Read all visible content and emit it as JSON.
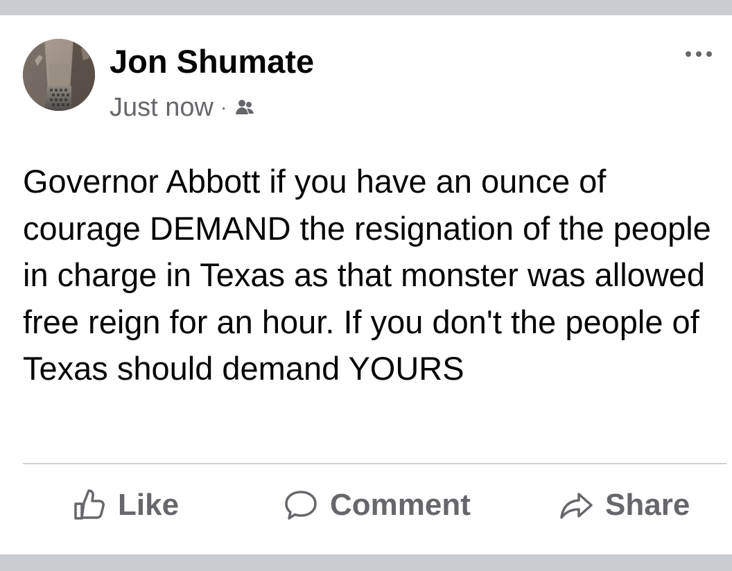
{
  "post": {
    "author": "Jon Shumate",
    "timestamp": "Just now",
    "separator": "·",
    "audience_icon": "friends-icon",
    "more_icon": "more-options-icon",
    "body": "Governor Abbott if you have an ounce of courage DEMAND the resignation of the people in charge in Texas as that monster was allowed free reign for an hour. If you don't the people of Texas should demand YOURS"
  },
  "actions": [
    {
      "label": "Like",
      "icon": "thumbs-up-icon"
    },
    {
      "label": "Comment",
      "icon": "comment-bubble-icon"
    },
    {
      "label": "Share",
      "icon": "share-arrow-icon"
    }
  ],
  "colors": {
    "page_background": "#c9ccd1",
    "card_background": "#ffffff",
    "primary_text": "#050505",
    "secondary_text": "#65676b",
    "divider": "#ced0d4"
  }
}
